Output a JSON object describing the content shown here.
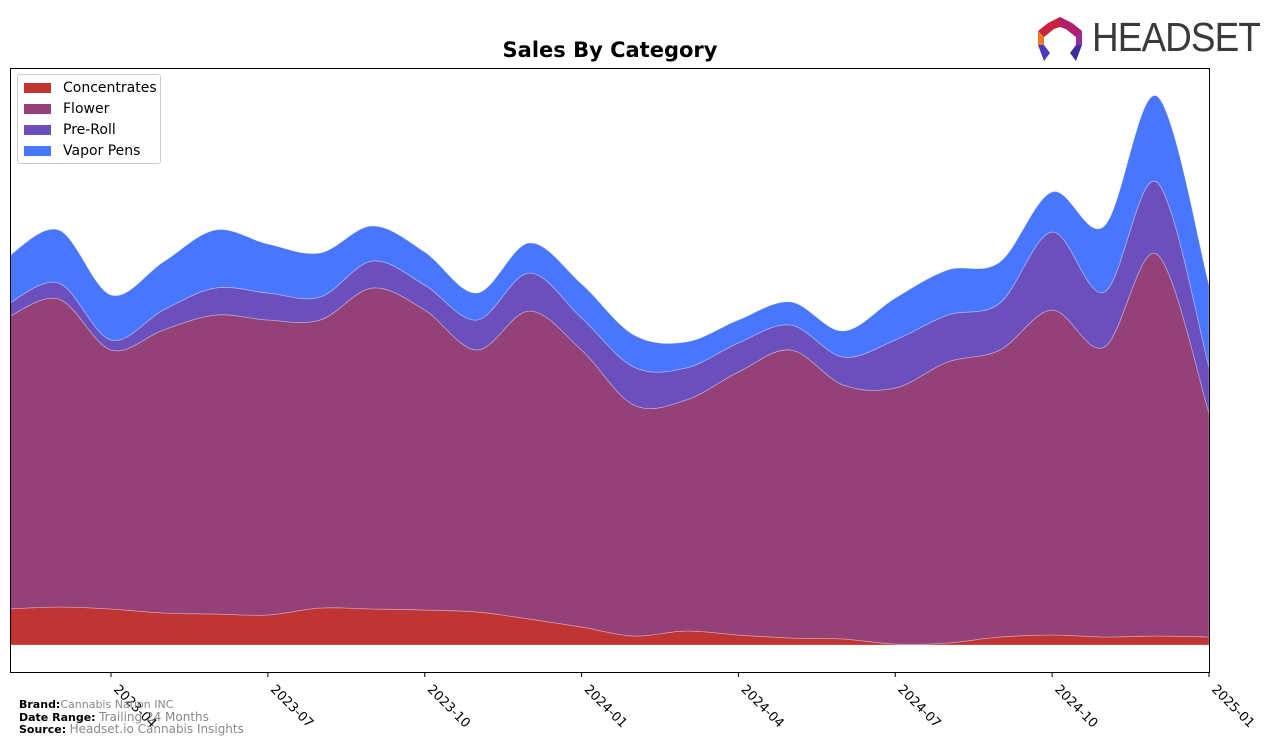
{
  "header": {
    "title": "Sales By Category",
    "logo_text": "HEADSET"
  },
  "footer": {
    "brand_label": "Brand:",
    "brand_value": "Cannabis Nation INC",
    "date_range_label": "Date Range:",
    "date_range_value": "Trailing 24 Months",
    "source_label": "Source:",
    "source_value": "Headset.io Cannabis Insights"
  },
  "chart_data": {
    "type": "area",
    "stacked": true,
    "title": "Sales By Category",
    "xlabel": "",
    "ylabel": "",
    "y_units": "relative (no y-axis shown)",
    "ylim": [
      0,
      576
    ],
    "grid": false,
    "legend_position": "top-left",
    "x": [
      "2023-02",
      "2023-03",
      "2023-04",
      "2023-05",
      "2023-06",
      "2023-07",
      "2023-08",
      "2023-09",
      "2023-10",
      "2023-11",
      "2023-12",
      "2024-01",
      "2024-02",
      "2024-03",
      "2024-04",
      "2024-05",
      "2024-06",
      "2024-07",
      "2024-08",
      "2024-09",
      "2024-10",
      "2024-11",
      "2024-12",
      "2025-01"
    ],
    "x_tick_labels": [
      "2023-04",
      "2023-07",
      "2023-10",
      "2024-01",
      "2024-04",
      "2024-07",
      "2024-10",
      "2025-01"
    ],
    "series": [
      {
        "name": "Concentrates",
        "color": "#c03434",
        "values": [
          36,
          38,
          36,
          32,
          31,
          30,
          37,
          36,
          35,
          33,
          26,
          18,
          9,
          14,
          10,
          7,
          6,
          1,
          2,
          8,
          10,
          8,
          9,
          8
        ]
      },
      {
        "name": "Flower",
        "color": "#944178",
        "values": [
          291,
          308,
          259,
          283,
          299,
          295,
          288,
          321,
          300,
          262,
          308,
          277,
          231,
          231,
          263,
          288,
          254,
          256,
          281,
          287,
          325,
          290,
          382,
          224
        ]
      },
      {
        "name": "Pre-Roll",
        "color": "#6a4fbd",
        "values": [
          13,
          16,
          10,
          20,
          27,
          27,
          23,
          27,
          25,
          30,
          38,
          32,
          38,
          32,
          29,
          25,
          28,
          48,
          47,
          47,
          78,
          55,
          72,
          46
        ]
      },
      {
        "name": "Vapor Pens",
        "color": "#4876fc",
        "values": [
          47,
          53,
          45,
          48,
          58,
          49,
          44,
          35,
          33,
          27,
          30,
          34,
          32,
          26,
          23,
          23,
          26,
          42,
          45,
          41,
          40,
          66,
          86,
          82
        ]
      }
    ]
  }
}
